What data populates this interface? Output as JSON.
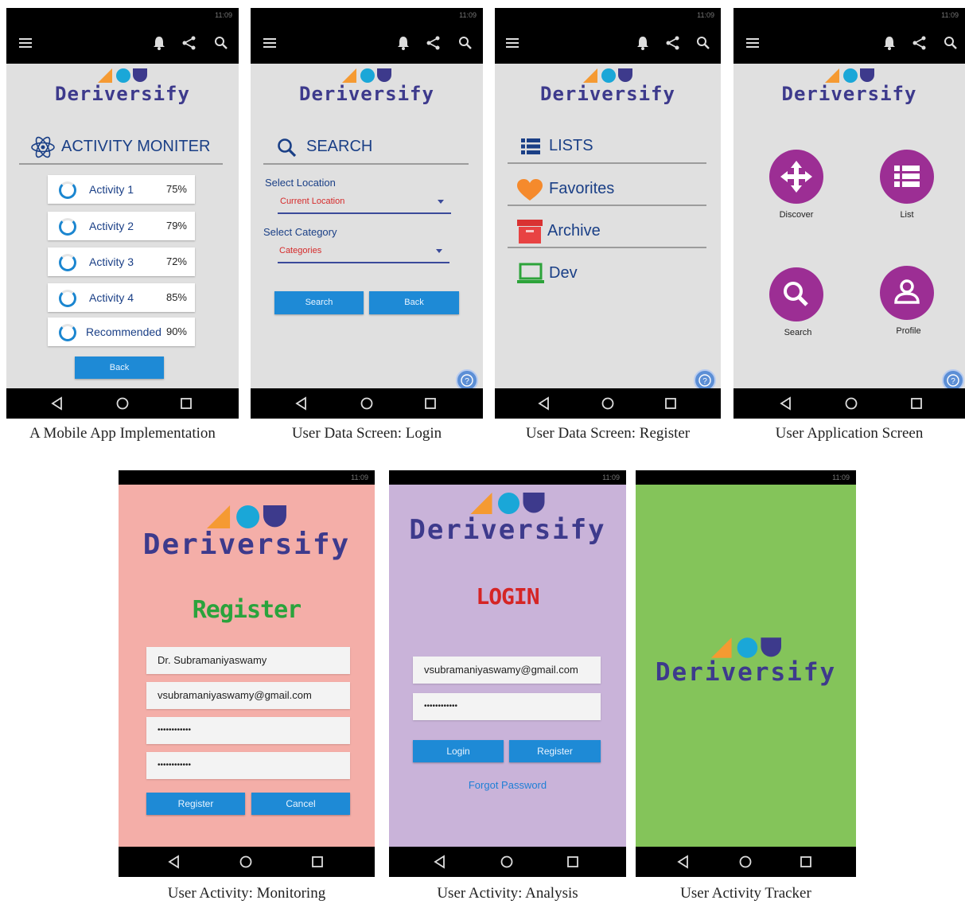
{
  "status_time": "11:09",
  "brand_name": "Deriversify",
  "captions": [
    "A Mobile App Implementation",
    "User Data Screen: Login",
    "User Data Screen: Register",
    "User Application Screen",
    "User Activity: Monitoring",
    "User Activity: Analysis",
    "User Activity Tracker"
  ],
  "activity": {
    "title": "ACTIVITY MONITER",
    "items": [
      {
        "label": "Activity 1",
        "pct": "75%"
      },
      {
        "label": "Activity 2",
        "pct": "79%"
      },
      {
        "label": "Activity 3",
        "pct": "72%"
      },
      {
        "label": "Activity 4",
        "pct": "85%"
      },
      {
        "label": "Recommended",
        "pct": "90%"
      }
    ],
    "back_label": "Back"
  },
  "search": {
    "title": "SEARCH",
    "location_label": "Select Location",
    "location_value": "Current Location",
    "category_label": "Select Category",
    "category_value": "Categories",
    "search_label": "Search",
    "back_label": "Back"
  },
  "lists": {
    "items": [
      {
        "label": "LISTS",
        "icon": "list-icon"
      },
      {
        "label": "Favorites",
        "icon": "heart-icon"
      },
      {
        "label": "Archive",
        "icon": "archive-icon"
      },
      {
        "label": "Dev",
        "icon": "laptop-icon"
      }
    ]
  },
  "home": {
    "tiles": [
      {
        "label": "Discover",
        "icon": "move-icon"
      },
      {
        "label": "List",
        "icon": "list-icon"
      },
      {
        "label": "Search",
        "icon": "search-icon"
      },
      {
        "label": "Profile",
        "icon": "user-icon"
      }
    ]
  },
  "register": {
    "title": "Register",
    "name_value": "Dr. Subramaniyaswamy",
    "email_value": "vsubramaniyaswamy@gmail.com",
    "password_value": "••••••••••••",
    "confirm_value": "••••••••••••",
    "register_label": "Register",
    "cancel_label": "Cancel"
  },
  "login": {
    "title": "LOGIN",
    "email_value": "vsubramaniyaswamy@gmail.com",
    "password_value": "••••••••••••",
    "login_label": "Login",
    "register_label": "Register",
    "forgot_label": "Forgot Password"
  },
  "colors": {
    "appbar": "#000000",
    "screen_gray": "#e0e0e0",
    "button_blue": "#1e8ad6",
    "register_bg": "#f4aea8",
    "login_bg": "#c9b3d9",
    "splash_bg": "#84c45a",
    "circle_purple": "#9c2e94",
    "brand_navy": "#3d3a8c",
    "register_green": "#2aa33c",
    "login_red": "#d52525"
  }
}
